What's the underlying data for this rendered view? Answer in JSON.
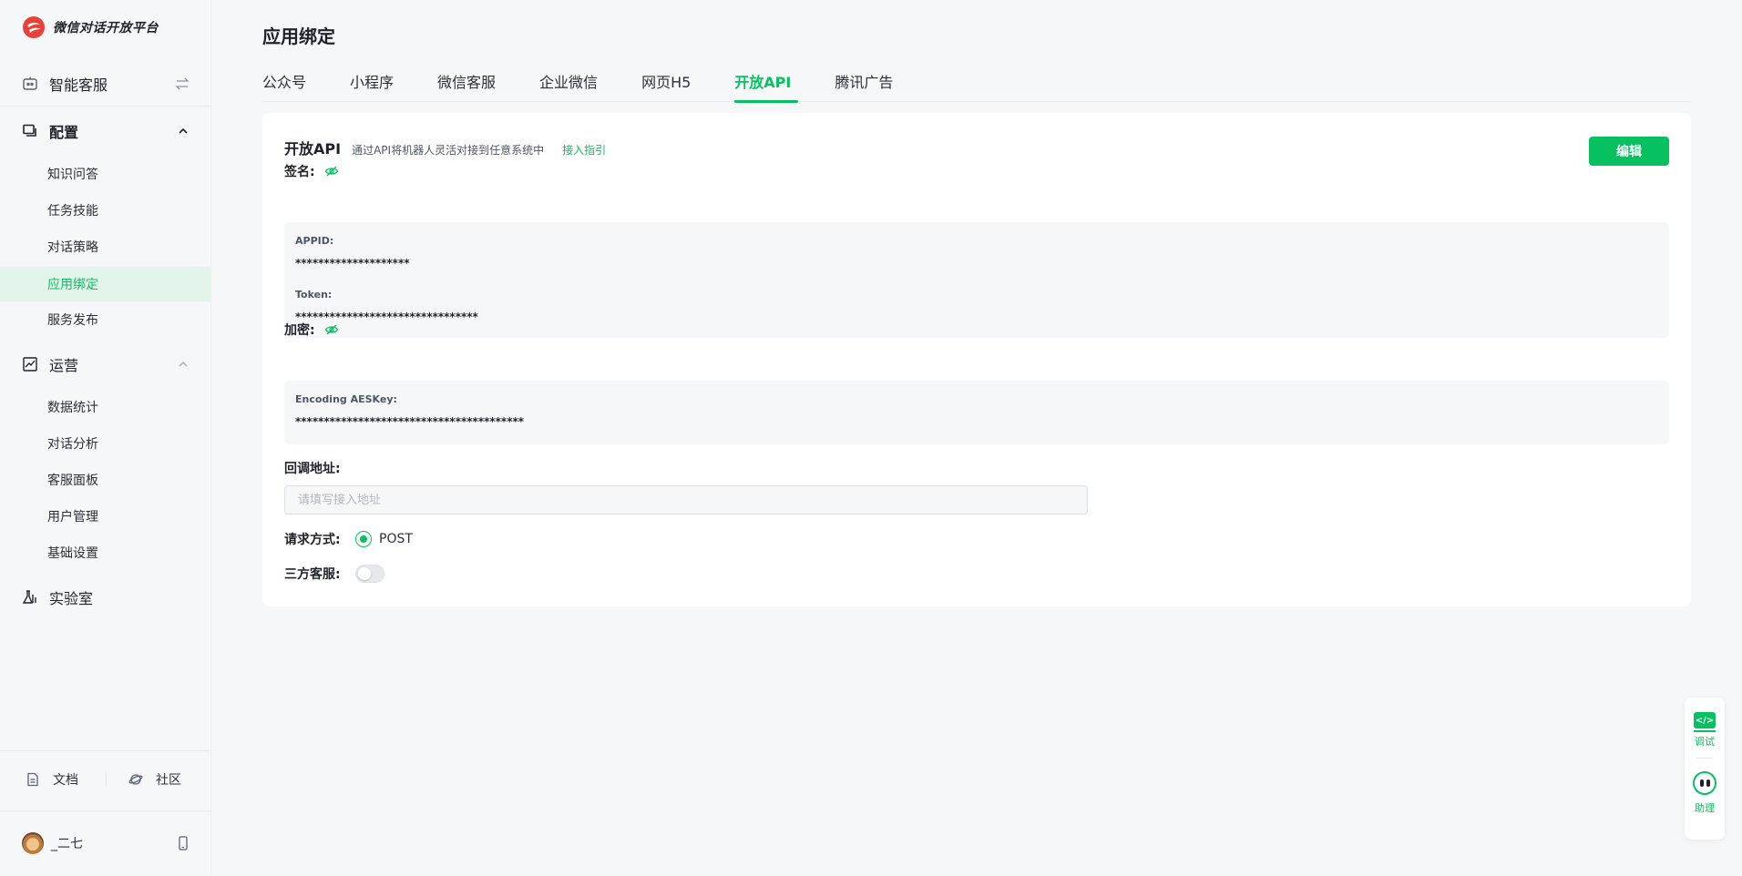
{
  "brand": {
    "name": "微信对话开放平台"
  },
  "sidebar": {
    "top_item": "智能客服",
    "groups": [
      {
        "label": "配置",
        "items": [
          "知识问答",
          "任务技能",
          "对话策略",
          "应用绑定",
          "服务发布"
        ],
        "active": "应用绑定"
      },
      {
        "label": "运营",
        "items": [
          "数据统计",
          "对话分析",
          "客服面板",
          "用户管理",
          "基础设置"
        ]
      },
      {
        "label": "实验室",
        "items": []
      }
    ],
    "footer": {
      "docs": "文档",
      "community": "社区"
    },
    "user": {
      "name": "_二七"
    }
  },
  "main": {
    "title": "应用绑定",
    "tabs": [
      "公众号",
      "小程序",
      "微信客服",
      "企业微信",
      "网页H5",
      "开放API",
      "腾讯广告"
    ],
    "active_tab": "开放API"
  },
  "card": {
    "title": "开放API",
    "description": "通过API将机器人灵活对接到任意系统中",
    "link": "接入指引",
    "edit_label": "编辑",
    "signature": {
      "label": "签名:",
      "appid_key": "APPID:",
      "appid_value": "********************",
      "token_key": "Token:",
      "token_value": "********************************"
    },
    "encryption": {
      "label": "加密:",
      "aes_key": "Encoding AESKey:",
      "aes_value": "****************************************"
    },
    "callback": {
      "label": "回调地址:",
      "placeholder": "请填写接入地址",
      "value": ""
    },
    "method": {
      "label": "请求方式:",
      "option": "POST",
      "selected": true
    },
    "third_party": {
      "label": "三方客服:",
      "enabled": false
    }
  },
  "float_tools": {
    "debug": "调试",
    "assistant": "助理"
  },
  "colors": {
    "accent": "#07c160",
    "brand_logo": "#e8413a"
  }
}
